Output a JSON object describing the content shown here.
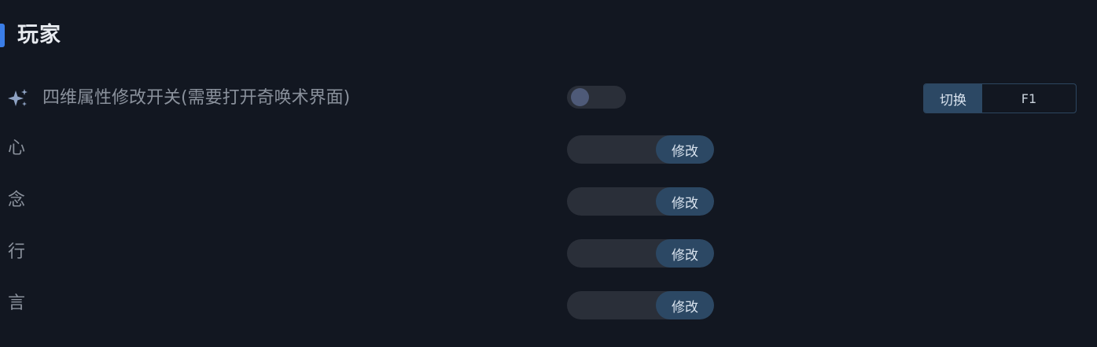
{
  "section": {
    "title": "玩家"
  },
  "toggle_row": {
    "icon": "sparkle-icon",
    "label": "四维属性修改开关(需要打开奇唤术界面)",
    "enabled": false,
    "hotkey_button_label": "切换",
    "hotkey_value": "F1"
  },
  "attributes": [
    {
      "label": "心",
      "value": "",
      "button_label": "修改"
    },
    {
      "label": "念",
      "value": "",
      "button_label": "修改"
    },
    {
      "label": "行",
      "value": "",
      "button_label": "修改"
    },
    {
      "label": "言",
      "value": "",
      "button_label": "修改"
    }
  ],
  "colors": {
    "background": "#121721",
    "accent": "#3b7ee8",
    "button": "#2c4864",
    "control": "#2a2f39"
  }
}
